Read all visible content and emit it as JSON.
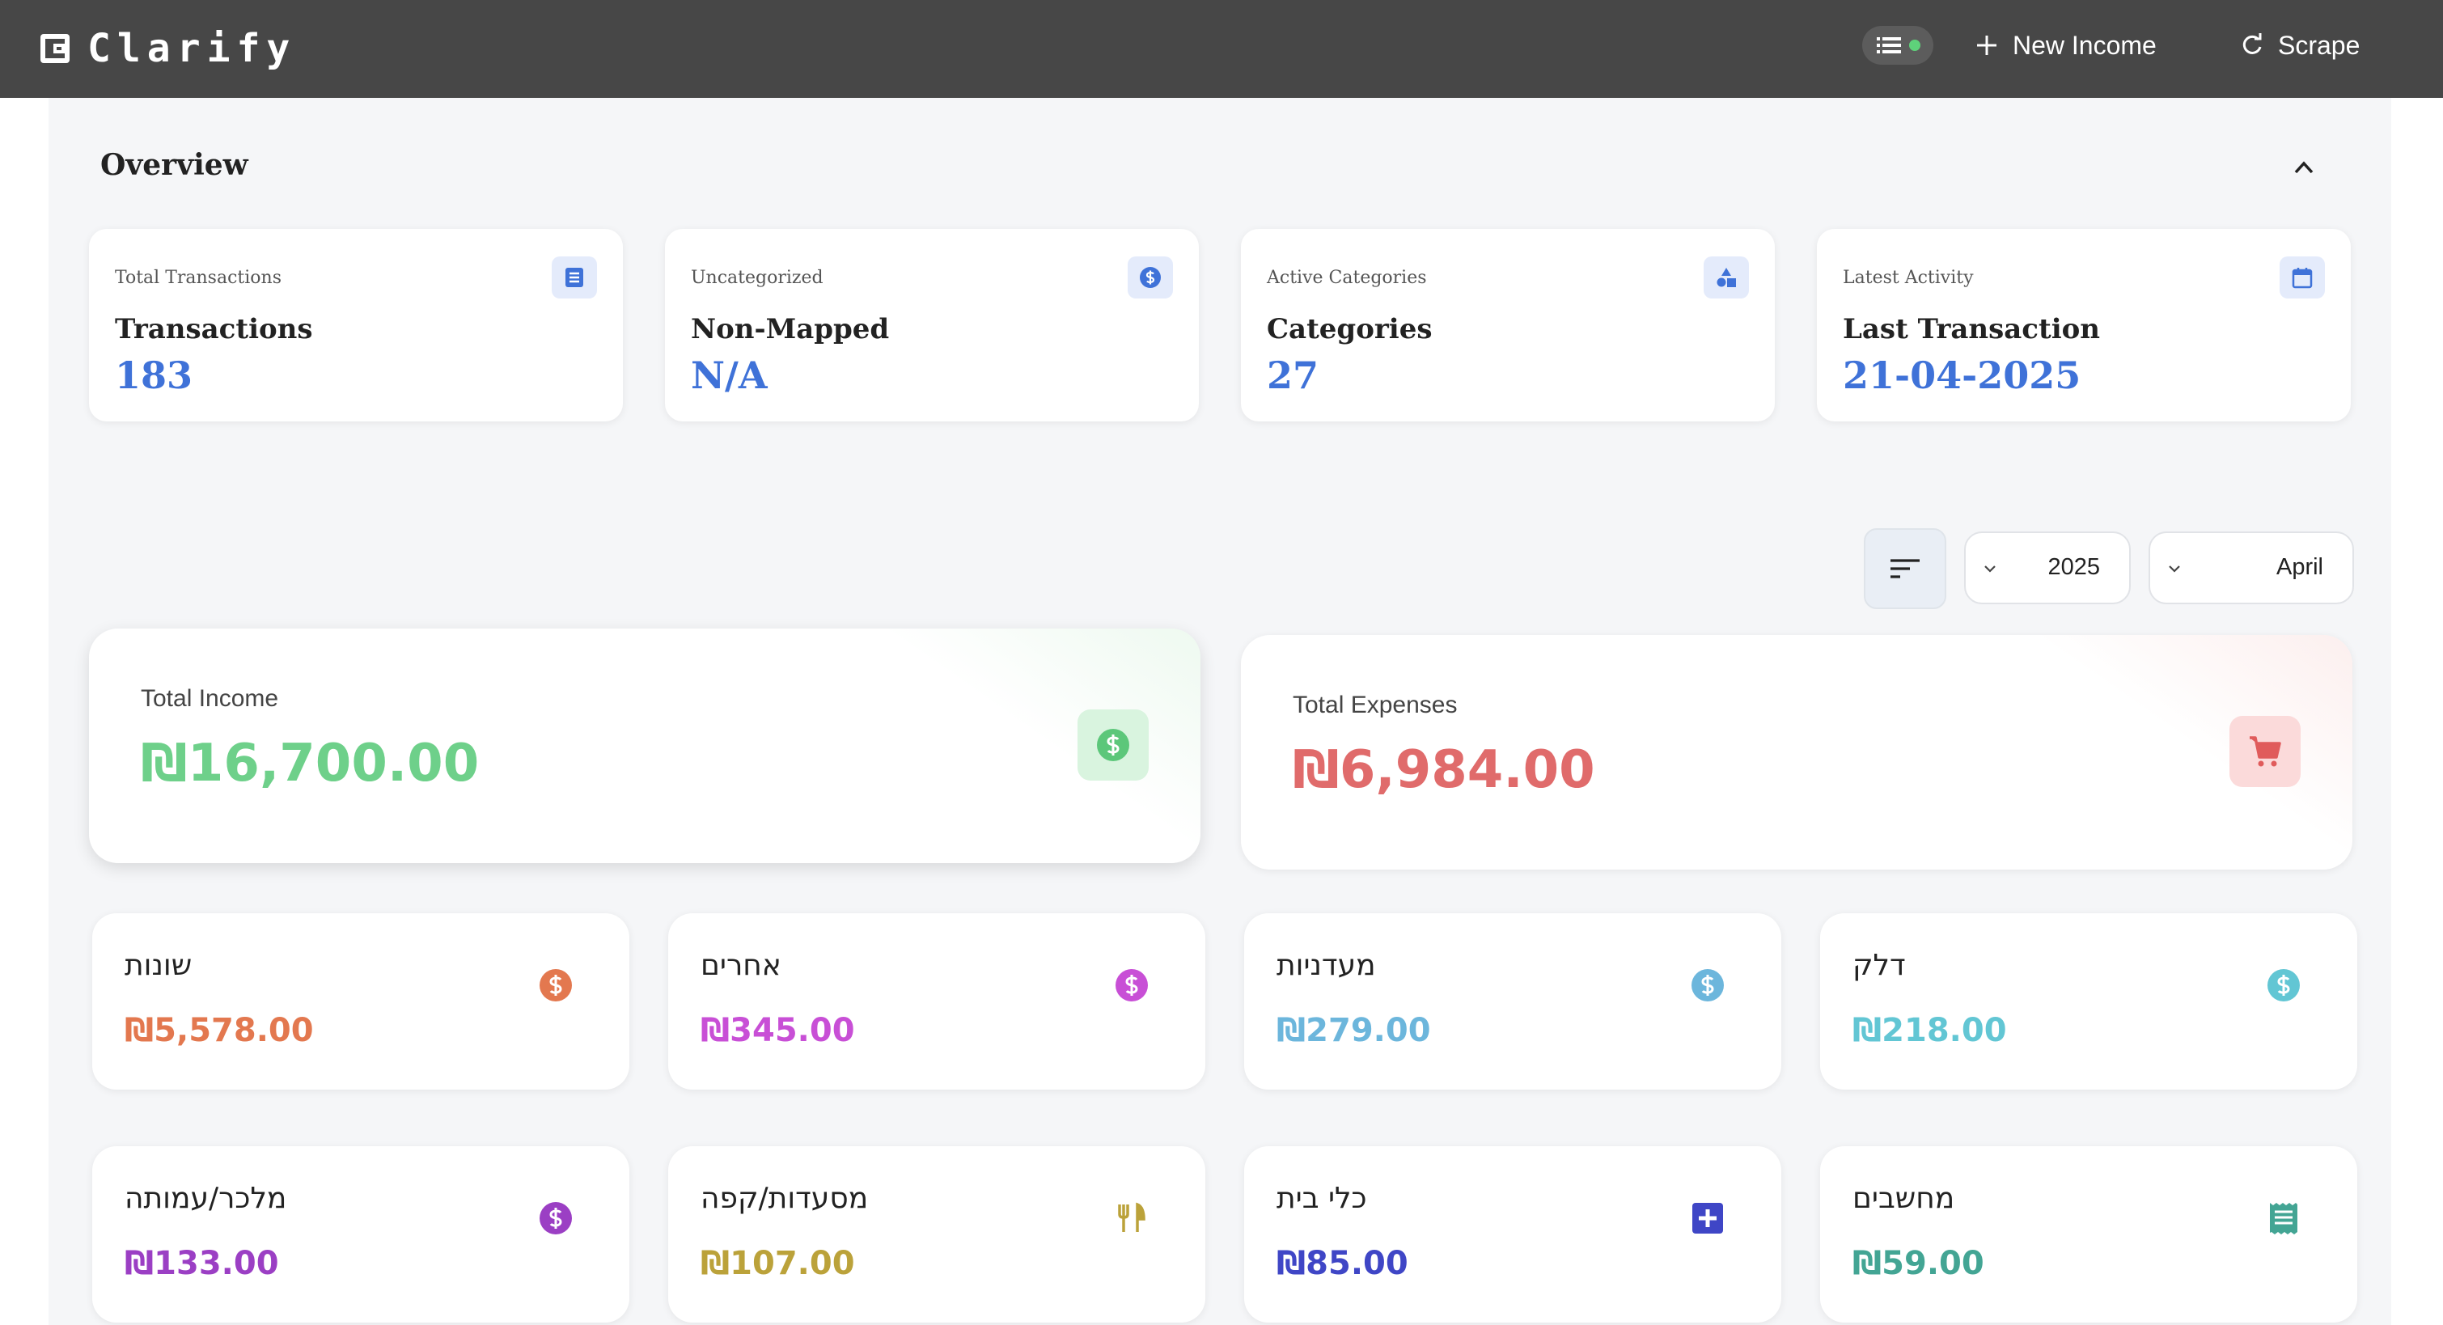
{
  "app": {
    "name": "Clarify"
  },
  "topbar": {
    "new_income": "New Income",
    "scrape": "Scrape"
  },
  "overview": {
    "title": "Overview",
    "stats": [
      {
        "sub": "Total Transactions",
        "title": "Transactions",
        "value": "183",
        "icon": "list-icon"
      },
      {
        "sub": "Uncategorized",
        "title": "Non-Mapped",
        "value": "N/A",
        "icon": "dollar-icon"
      },
      {
        "sub": "Active Categories",
        "title": "Categories",
        "value": "27",
        "icon": "shapes-icon"
      },
      {
        "sub": "Latest Activity",
        "title": "Last Transaction",
        "value": "21-04-2025",
        "icon": "calendar-icon"
      }
    ]
  },
  "filters": {
    "year": "2025",
    "month": "April"
  },
  "totals": {
    "income_label": "Total Income",
    "income_value": "₪16,700.00",
    "expenses_label": "Total Expenses",
    "expenses_value": "₪6,984.00"
  },
  "categories": [
    {
      "name": "שונות",
      "value": "₪5,578.00",
      "color": "#e3784f",
      "icon": "dollar-icon"
    },
    {
      "name": "אחרים",
      "value": "₪345.00",
      "color": "#c84fd6",
      "icon": "dollar-icon"
    },
    {
      "name": "מעדניות",
      "value": "₪279.00",
      "color": "#6cb6dc",
      "icon": "dollar-icon"
    },
    {
      "name": "דלק",
      "value": "₪218.00",
      "color": "#62c6d4",
      "icon": "dollar-icon"
    },
    {
      "name": "מלכר/עמותה",
      "value": "₪133.00",
      "color": "#9b3fc4",
      "icon": "dollar-icon"
    },
    {
      "name": "מסעדות/קפה",
      "value": "₪107.00",
      "color": "#bba23a",
      "icon": "restaurant-icon"
    },
    {
      "name": "כלי בית",
      "value": "₪85.00",
      "color": "#3f46c6",
      "icon": "plus-box-icon"
    },
    {
      "name": "מחשבים",
      "value": "₪59.00",
      "color": "#43a594",
      "icon": "receipt-icon"
    }
  ]
}
